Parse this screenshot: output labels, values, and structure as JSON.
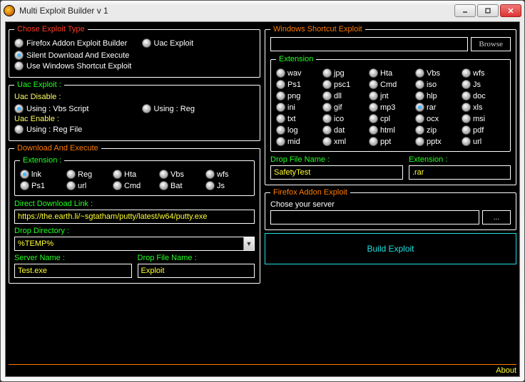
{
  "window": {
    "title": "Multi Exploit Builder v 1"
  },
  "left": {
    "chose": {
      "legend": "Chose Exploit Type",
      "opt1": "Firefox Addon Exploit Builder",
      "opt2": "Uac Exploit",
      "opt3": "Silent Download And Execute",
      "opt4": "Use Windows Shortcut Exploit"
    },
    "uac": {
      "legend": "Uac Exploit :",
      "disable_lbl": "Uac Disable :",
      "vbs": "Using : Vbs Script",
      "reg": "Using : Reg",
      "enable_lbl": "Uac Enable :",
      "regfile": "Using : Reg File"
    },
    "dae": {
      "legend": "Download And Execute",
      "ext_legend": "Extension :",
      "exts": [
        "lnk",
        "Reg",
        "Hta",
        "Vbs",
        "wfs",
        "Ps1",
        "url",
        "Cmd",
        "Bat",
        "Js"
      ],
      "ddl_lbl": "Direct Download Link :",
      "ddl_val": "https://the.earth.li/~sgtatham/putty/latest/w64/putty.exe",
      "drop_lbl": "Drop Directory :",
      "drop_val": "%TEMP%",
      "server_lbl": "Server Name :",
      "server_val": "Test.exe",
      "file_lbl": "Drop File Name :",
      "file_val": "Exploit"
    }
  },
  "right": {
    "wse": {
      "legend": "Windows Shortcut Exploit",
      "browse": "Browse",
      "ext_legend": "Extension",
      "exts": [
        "wav",
        "jpg",
        "Hta",
        "Vbs",
        "wfs",
        "Ps1",
        "psc1",
        "Cmd",
        "iso",
        "Js",
        "png",
        "dll",
        "jnt",
        "hlp",
        "doc",
        "ini",
        "gif",
        "mp3",
        "rar",
        "xls",
        "txt",
        "ico",
        "cpl",
        "ocx",
        "msi",
        "log",
        "dat",
        "html",
        "zip",
        "pdf",
        "mid",
        "xml",
        "ppt",
        "pptx",
        "url"
      ],
      "selected": "rar",
      "drop_lbl": "Drop File Name :",
      "drop_val": "SafetyTest",
      "extn_lbl": "Extension :",
      "extn_val": ".rar"
    },
    "fae": {
      "legend": "Firefox Addon Exploit",
      "chose": "Chose your server",
      "ellipsis": "..."
    },
    "build": "Build Exploit"
  },
  "footer": {
    "about": "About"
  }
}
